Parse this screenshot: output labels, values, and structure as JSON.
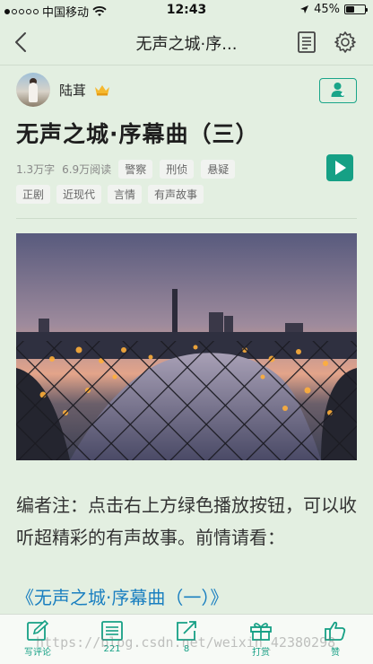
{
  "status_bar": {
    "carrier": "中国移动",
    "time": "12:43",
    "battery_percent": "45%",
    "battery_level": 0.45,
    "signal_bars": 1
  },
  "nav": {
    "title": "无声之城·序...",
    "icons": [
      "back-icon",
      "document-icon",
      "gear-icon"
    ]
  },
  "author": {
    "name": "陆茸",
    "badge_icon": "crown-icon"
  },
  "story": {
    "title": "无声之城·序幕曲（三）",
    "word_count": "1.3万字",
    "reads": "6.9万阅读",
    "tags_row1": [
      "警察",
      "刑侦",
      "悬疑"
    ],
    "tags_row2": [
      "正剧",
      "近现代",
      "言情",
      "有声故事"
    ]
  },
  "body": {
    "text": "编者注：点击右上方绿色播放按钮，可以收听超精彩的有声故事。前情请看：",
    "link": "《无声之城·序幕曲（一）》"
  },
  "bottom_bar": {
    "items": [
      {
        "label": "写评论",
        "icon": "edit-icon"
      },
      {
        "label": "221",
        "icon": "list-icon"
      },
      {
        "label": "8",
        "icon": "share-icon"
      },
      {
        "label": "打赏",
        "icon": "gift-icon"
      },
      {
        "label": "赞",
        "icon": "thumbs-up-icon"
      }
    ]
  },
  "watermark": "https://blog.csdn.net/weixin_42380298",
  "colors": {
    "accent": "#16a085",
    "link": "#1a7fc0",
    "background": "#e3efe1"
  }
}
